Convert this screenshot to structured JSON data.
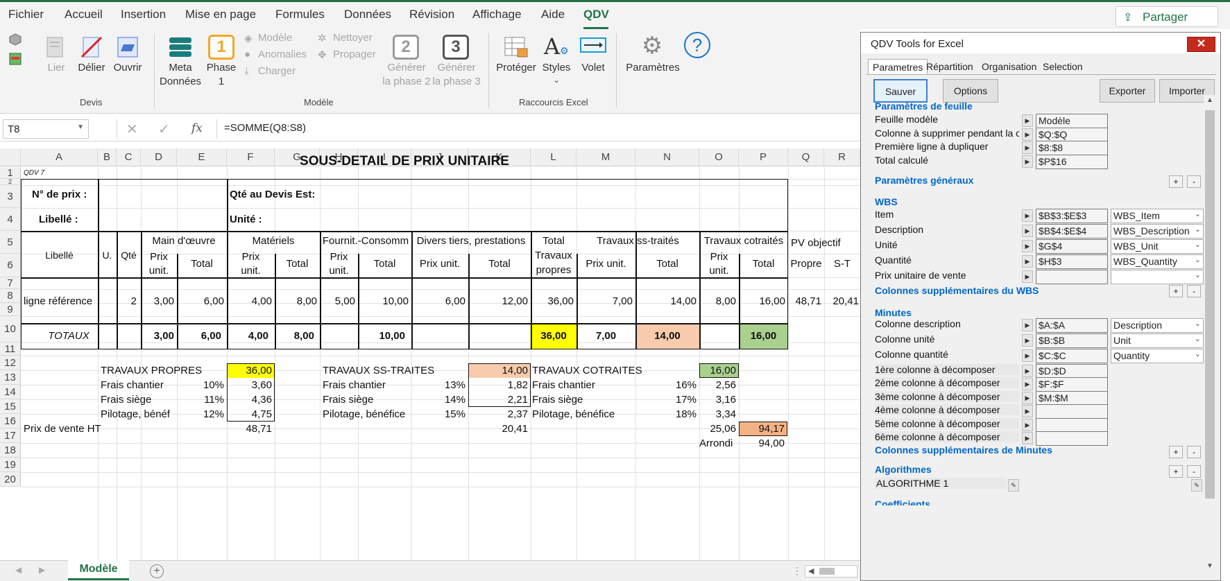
{
  "menu": {
    "items": [
      "Fichier",
      "Accueil",
      "Insertion",
      "Mise en page",
      "Formules",
      "Données",
      "Révision",
      "Affichage",
      "Aide",
      "QDV"
    ],
    "share": "Partager"
  },
  "ribbon": {
    "devis": {
      "lier": "Lier",
      "delier": "Délier",
      "ouvrir": "Ouvrir",
      "group": "Devis"
    },
    "modele": {
      "meta_line1": "Meta",
      "meta_line2": "Données",
      "phase1_line1": "Phase",
      "phase1_line2": "1",
      "phase1_num": "1",
      "modele": "Modèle",
      "anomalies": "Anomalies",
      "charger": "Charger",
      "nettoyer": "Nettoyer",
      "propager": "Propager",
      "gen2_line1": "Générer",
      "gen2_line2": "la phase 2",
      "gen2_num": "2",
      "gen3_line1": "Générer",
      "gen3_line2": "la phase 3",
      "gen3_num": "3",
      "group": "Modèle"
    },
    "raccourcis": {
      "proteger": "Protéger",
      "styles": "Styles",
      "volet": "Volet",
      "group": "Raccourcis Excel"
    },
    "parametres": "Paramètres",
    "help": "?"
  },
  "formula_bar": {
    "cell": "T8",
    "formula": "=SOMME(Q8:S8)",
    "fx": "fx"
  },
  "columns": [
    "A",
    "B",
    "C",
    "D",
    "E",
    "F",
    "G",
    "H",
    "I",
    "J",
    "K",
    "L",
    "M",
    "N",
    "O",
    "P",
    "Q",
    "R"
  ],
  "rows": [
    "1",
    "2",
    "3",
    "4",
    "5",
    "6",
    "7",
    "8",
    "9",
    "10",
    "11",
    "12",
    "13",
    "14",
    "15",
    "16",
    "17",
    "18",
    "19",
    "20"
  ],
  "sheet": {
    "title": "SOUS-DETAIL DE PRIX UNITAIRE",
    "qdv": "QDV 7",
    "no_prix": "N° de prix :",
    "qte_devis": "Qté au Devis Est:",
    "libelle": "Libellé :",
    "unite": "Unité :",
    "hdr": {
      "libelle": "Libellé",
      "u": "U.",
      "qte": "Qté",
      "main": "Main d'œuvre",
      "materiels": "Matériels",
      "fournit": "Fournit.-Consomm",
      "divers": "Divers tiers, prestations",
      "total": "Total",
      "travaux_propres": "Travaux",
      "propres": "propres",
      "ss_traites": "Travaux ss-traités",
      "cotraites": "Travaux cotraités",
      "pv_objectif": "PV objectif",
      "prix": "Prix",
      "unit": "unit.",
      "total_col": "Total",
      "prix_unit": "Prix unit.",
      "propre": "Propre",
      "st": "S-T"
    },
    "row8": {
      "label": "ligne référence",
      "c": "2",
      "d": "3,00",
      "e": "6,00",
      "f": "4,00",
      "g": "8,00",
      "h": "5,00",
      "i": "10,00",
      "j": "6,00",
      "k": "12,00",
      "l": "36,00",
      "m": "7,00",
      "n": "14,00",
      "o": "8,00",
      "p": "16,00",
      "q": "48,71",
      "r": "20,41"
    },
    "row10": {
      "label": "TOTAUX",
      "d": "3,00",
      "e": "6,00",
      "f": "4,00",
      "g": "8,00",
      "i": "10,00",
      "l": "36,00",
      "m": "7,00",
      "n": "14,00",
      "p": "16,00"
    },
    "summary": {
      "tp": "TRAVAUX PROPRES",
      "tp_val": "36,00",
      "fc": "Frais chantier",
      "fc_pct": "10%",
      "fc_val": "3,60",
      "fs": "Frais siège",
      "fs_pct": "11%",
      "fs_val": "4,36",
      "pb": "Pilotage, bénéf",
      "pb_pct": "12%",
      "pb_val": "4,75",
      "pv": "Prix de vente HT",
      "pv_val": "48,71",
      "st": "TRAVAUX SS-TRAITES",
      "st_val": "14,00",
      "st_fc": "Frais chantier",
      "st_fc_pct": "13%",
      "st_fc_val": "1,82",
      "st_fs": "Frais siège",
      "st_fs_pct": "14%",
      "st_fs_val": "2,21",
      "st_pb": "Pilotage, bénéfice",
      "st_pb_pct": "15%",
      "st_pb_val": "2,37",
      "st_pv": "20,41",
      "ct": "TRAVAUX COTRAITES",
      "ct_val": "16,00",
      "ct_fc": "Frais chantier",
      "ct_fc_pct": "16%",
      "ct_fc_val": "2,56",
      "ct_fs": "Frais siège",
      "ct_fs_pct": "17%",
      "ct_fs_val": "3,16",
      "ct_pb": "Pilotage, bénéfice",
      "ct_pb_pct": "18%",
      "ct_pb_val": "3,34",
      "ct_pv": "25,06",
      "total": "94,17",
      "arrondi": "Arrondi",
      "arrondi_val": "94,00"
    }
  },
  "sheet_tab": "Modèle",
  "panel": {
    "title": "QDV Tools for Excel",
    "close": "✕",
    "tabs": [
      "Parametres",
      "Répartition",
      "Organisation",
      "Selection"
    ],
    "buttons": {
      "sauver": "Sauver",
      "options": "Options",
      "exporter": "Exporter",
      "importer": "Importer"
    },
    "sec_feuille": "Paramètres de feuille",
    "feuille": [
      {
        "label": "Feuille modèle",
        "value": "Modèle"
      },
      {
        "label": "Colonne à supprimer pendant la co",
        "value": "$Q:$Q"
      },
      {
        "label": "Première ligne à dupliquer",
        "value": "$8:$8"
      },
      {
        "label": "Total calculé",
        "value": "$P$16"
      }
    ],
    "sec_generaux": "Paramètres généraux",
    "sec_wbs": "WBS",
    "wbs": [
      {
        "label": "Item",
        "value": "$B$3:$E$3",
        "select": "WBS_Item"
      },
      {
        "label": "Description",
        "value": "$B$4:$E$4",
        "select": "WBS_Description"
      },
      {
        "label": "Unité",
        "value": "$G$4",
        "select": "WBS_Unit"
      },
      {
        "label": "Quantité",
        "value": "$H$3",
        "select": "WBS_Quantity"
      },
      {
        "label": "Prix unitaire de vente",
        "value": "",
        "select": ""
      }
    ],
    "sec_wbs_supp": "Colonnes supplémentaires du WBS",
    "sec_minutes": "Minutes",
    "minutes": [
      {
        "label": "Colonne description",
        "value": "$A:$A",
        "select": "Description"
      },
      {
        "label": "Colonne unité",
        "value": "$B:$B",
        "select": "Unit"
      },
      {
        "label": "Colonne quantité",
        "value": "$C:$C",
        "select": "Quantity"
      }
    ],
    "decomp": [
      {
        "label": "1ère colonne à décomposer",
        "value": "$D:$D"
      },
      {
        "label": "2ème colonne à décomposer",
        "value": "$F:$F"
      },
      {
        "label": "3ème colonne à décomposer",
        "value": "$M:$M"
      },
      {
        "label": "4ème colonne à décomposer",
        "value": ""
      },
      {
        "label": "5ème colonne à décomposer",
        "value": ""
      },
      {
        "label": "6ème colonne à décomposer",
        "value": ""
      }
    ],
    "sec_min_supp": "Colonnes supplémentaires de Minutes",
    "sec_algo": "Algorithmes",
    "algo": "ALGORITHME 1",
    "sec_coef": "Coefficients",
    "plus": "+",
    "minus": "-"
  },
  "colors": {
    "excel_green": "#217346",
    "yellow": "#ffff00",
    "peach": "#f8cbad",
    "green": "#a9d08e",
    "orange": "#f4b183",
    "link_blue": "#0066cc"
  }
}
